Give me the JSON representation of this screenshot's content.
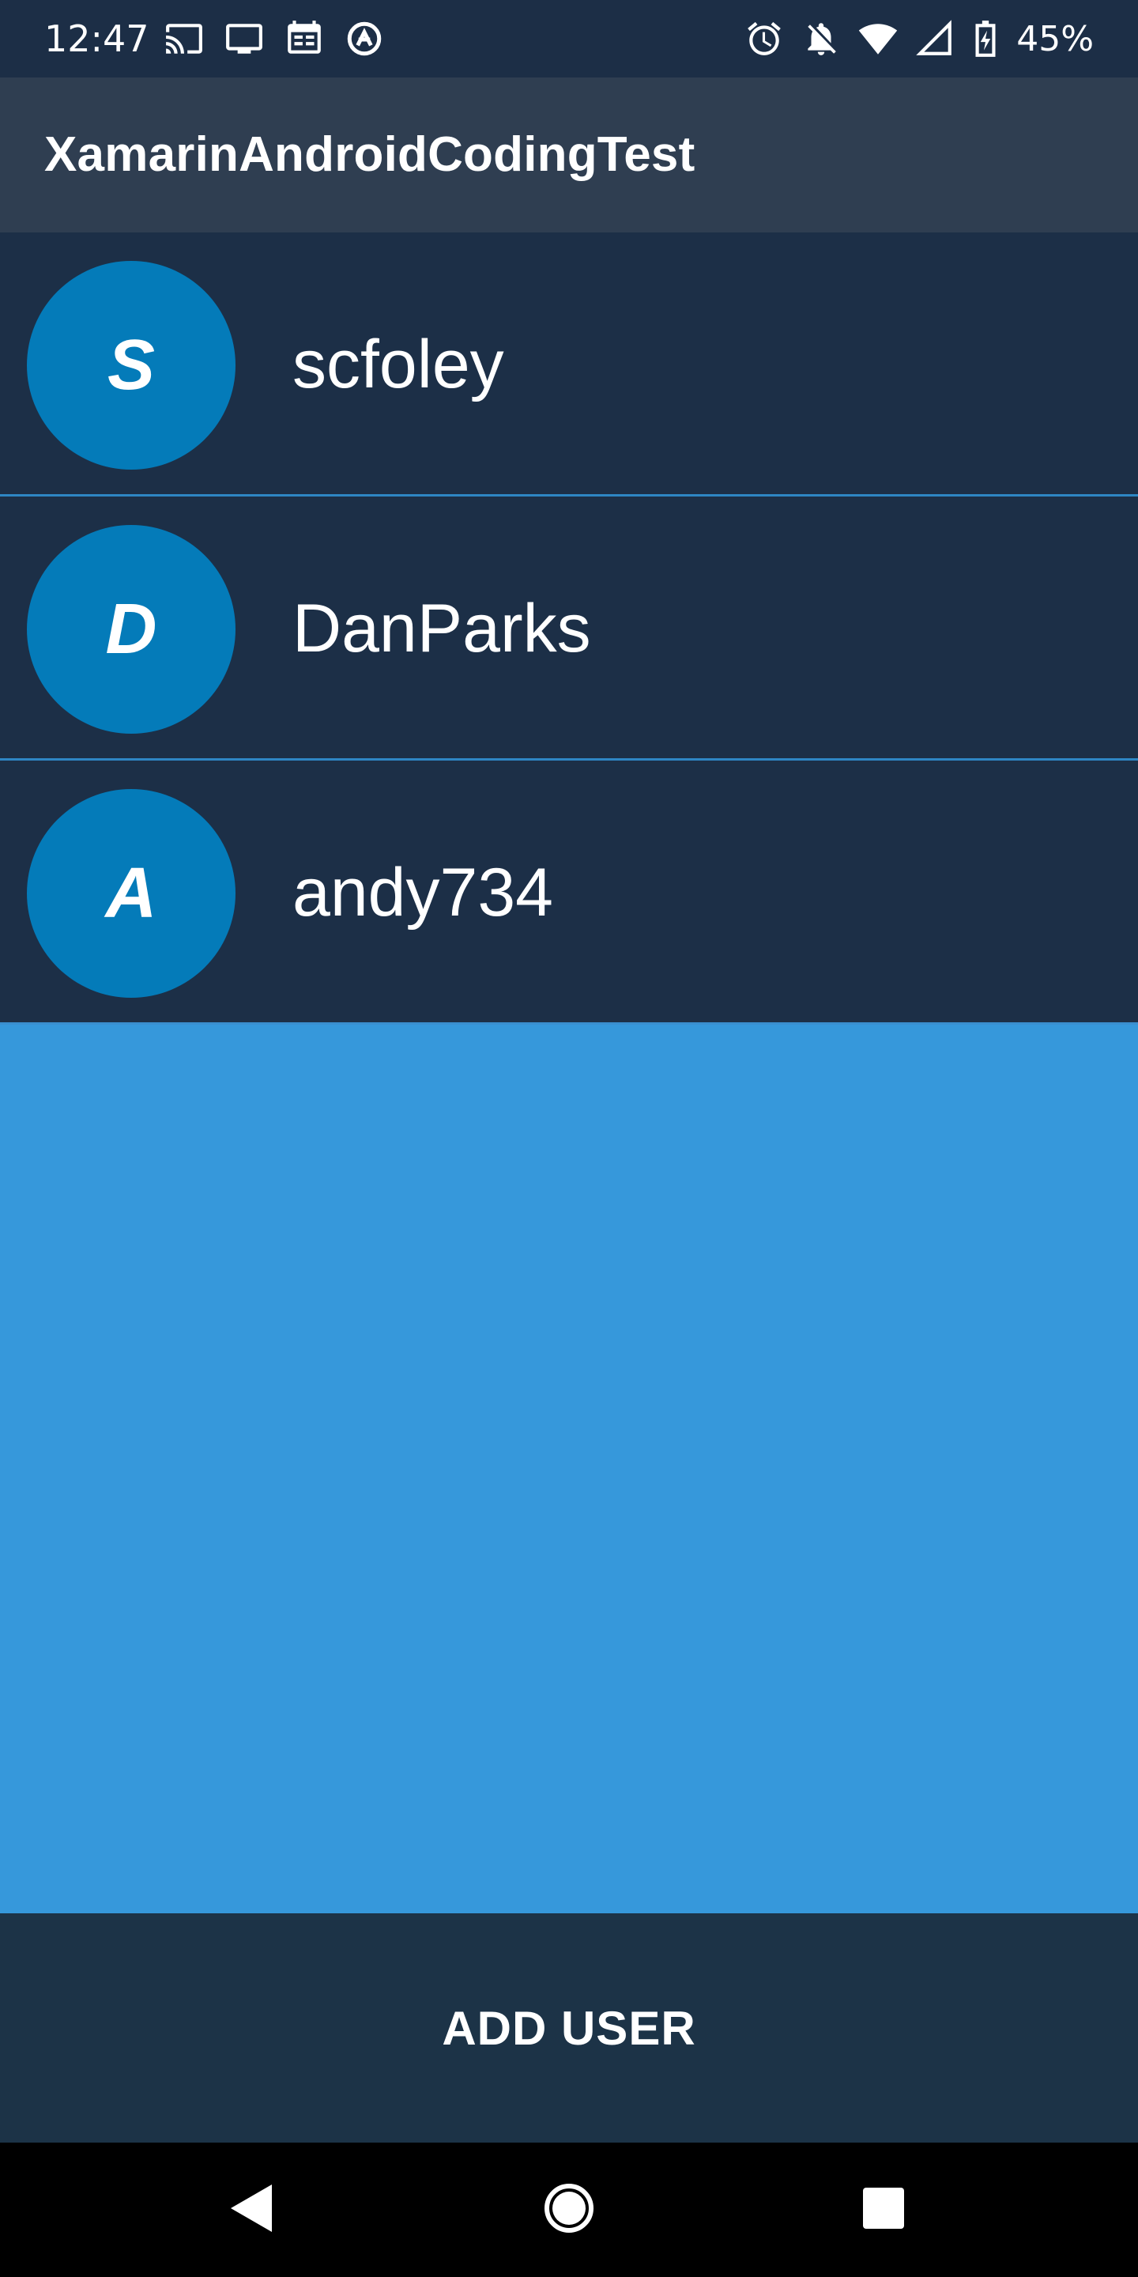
{
  "status_bar": {
    "time": "12:47",
    "battery_percent": "45%",
    "left_icons": [
      "cast-icon",
      "monitor-icon",
      "calendar-icon",
      "vpn-icon"
    ],
    "right_icons": [
      "alarm-icon",
      "notifications-off-icon",
      "wifi-icon",
      "signal-icon",
      "battery-charging-icon"
    ]
  },
  "app_bar": {
    "title": "XamarinAndroidCodingTest"
  },
  "users": [
    {
      "initial": "S",
      "name": "scfoley"
    },
    {
      "initial": "D",
      "name": "DanParks"
    },
    {
      "initial": "A",
      "name": "andy734"
    }
  ],
  "add_user_label": "ADD USER",
  "nav_bar": {
    "icons": [
      "back-icon",
      "home-icon",
      "recents-icon"
    ]
  },
  "colors": {
    "status_bar": "#1c2e46",
    "app_bar": "#2f3e51",
    "list_row": "#1c2f47",
    "avatar": "#047bb9",
    "list_background": "#3698db",
    "button_background": "#1c3347",
    "nav_bar": "#000000"
  }
}
